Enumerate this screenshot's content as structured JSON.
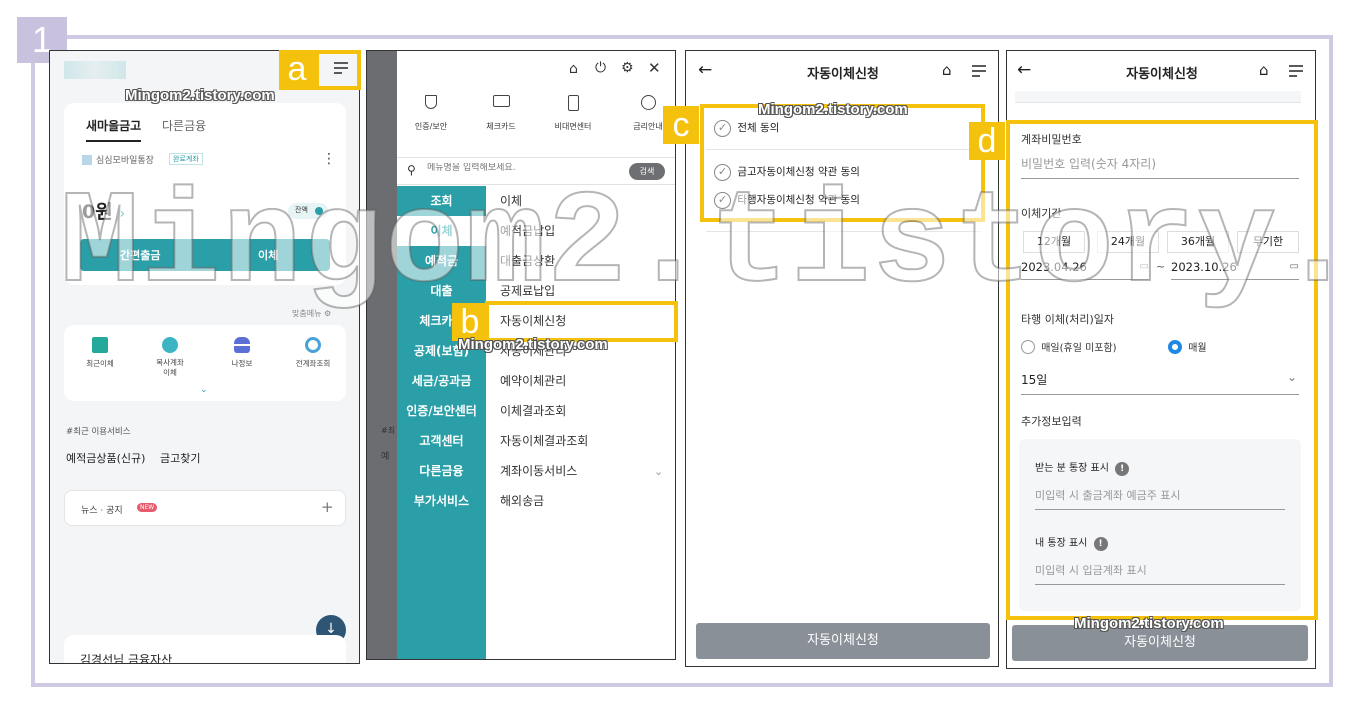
{
  "step": "1",
  "watermark": "Mingom2.tistory.com",
  "watermark_big": "Mingom2.tistory.com",
  "markers": {
    "a": "a",
    "b": "b",
    "c": "c",
    "d": "d"
  },
  "colors": {
    "accent": "#2a9fa8",
    "highlight": "#f4c20d",
    "frame": "#cfc9e4",
    "button_gray": "#8a9097",
    "radio_on": "#1e88e5"
  },
  "screen1": {
    "tabs": [
      "새마을금고",
      "다른금융"
    ],
    "account_name": "심심모바일통장",
    "account_badge": "완료계좌",
    "balance": "0원",
    "balance_chevron": "›",
    "toggle_label": "잔액",
    "btn_quick": "간편출금",
    "btn_transfer": "이체",
    "custom_menu": "맞춤메뉴",
    "quick_items": [
      {
        "label": "최근이체",
        "icon": "recent-transfer-icon"
      },
      {
        "label": "복사계좌\n이체",
        "icon": "copy-account-icon"
      },
      {
        "label": "나정보",
        "icon": "profile-icon"
      },
      {
        "label": "전계좌조회",
        "icon": "all-accounts-icon"
      }
    ],
    "recent_heading": "#최근 이용서비스",
    "recent_links": [
      "예적금상품(신규)",
      "금고찾기"
    ],
    "news_label": "뉴스 · 공지",
    "news_badge": "NEW",
    "news_plus": "+",
    "bottom_text": "김경선님 금융자산"
  },
  "screen2": {
    "top_icons": [
      "home-icon",
      "power-icon",
      "gear-icon",
      "close-icon"
    ],
    "quick": [
      {
        "label": "인증/보안",
        "icon": "shield-icon"
      },
      {
        "label": "체크카드",
        "icon": "card-icon"
      },
      {
        "label": "비대면센터",
        "icon": "phone-icon"
      },
      {
        "label": "금리안내",
        "icon": "rate-icon"
      }
    ],
    "search_placeholder": "메뉴명을 입력해보세요.",
    "search_button": "검색",
    "left_menu": [
      "조회",
      "이체",
      "예적금",
      "대출",
      "체크카드",
      "공제(보험)",
      "세금/공과금",
      "인증/보안센터",
      "고객센터",
      "다른금융",
      "부가서비스"
    ],
    "left_active_index": 1,
    "right_menu": [
      "이체",
      "예적금납입",
      "대출금상환",
      "공제료납입",
      "자동이체신청",
      "자동이체관리",
      "예약이체관리",
      "이체결과조회",
      "자동이체결과조회",
      "계좌이동서비스",
      "해외송금"
    ],
    "bg_partial": [
      "#최",
      "예"
    ]
  },
  "screen3": {
    "title": "자동이체신청",
    "all_agree": "전체 동의",
    "agree1": "금고자동이체신청 약관 동의",
    "agree2": "타행자동이체신청 약관 동의",
    "submit": "자동이체신청"
  },
  "screen4": {
    "title": "자동이체신청",
    "pw_label": "계좌비밀번호",
    "pw_placeholder": "비밀번호 입력(숫자 4자리)",
    "period_label": "이체기간",
    "periods": [
      "12개월",
      "24개월",
      "36개월",
      "무기한"
    ],
    "start_date": "2023.04.26",
    "date_sep": "~",
    "end_date": "2023.10.26",
    "other_bank_label": "타행 이체(처리)일자",
    "radio1": "매일(휴일 미포함)",
    "radio2": "매월",
    "radio_selected": 2,
    "day_value": "15일",
    "extra_label": "추가정보입력",
    "recv_label": "받는 분 통장 표시",
    "recv_placeholder": "미입력 시 출금계좌 예금주 표시",
    "my_label": "내 통장 표시",
    "my_placeholder": "미입력 시 입금계좌 표시",
    "submit": "자동이체신청"
  }
}
